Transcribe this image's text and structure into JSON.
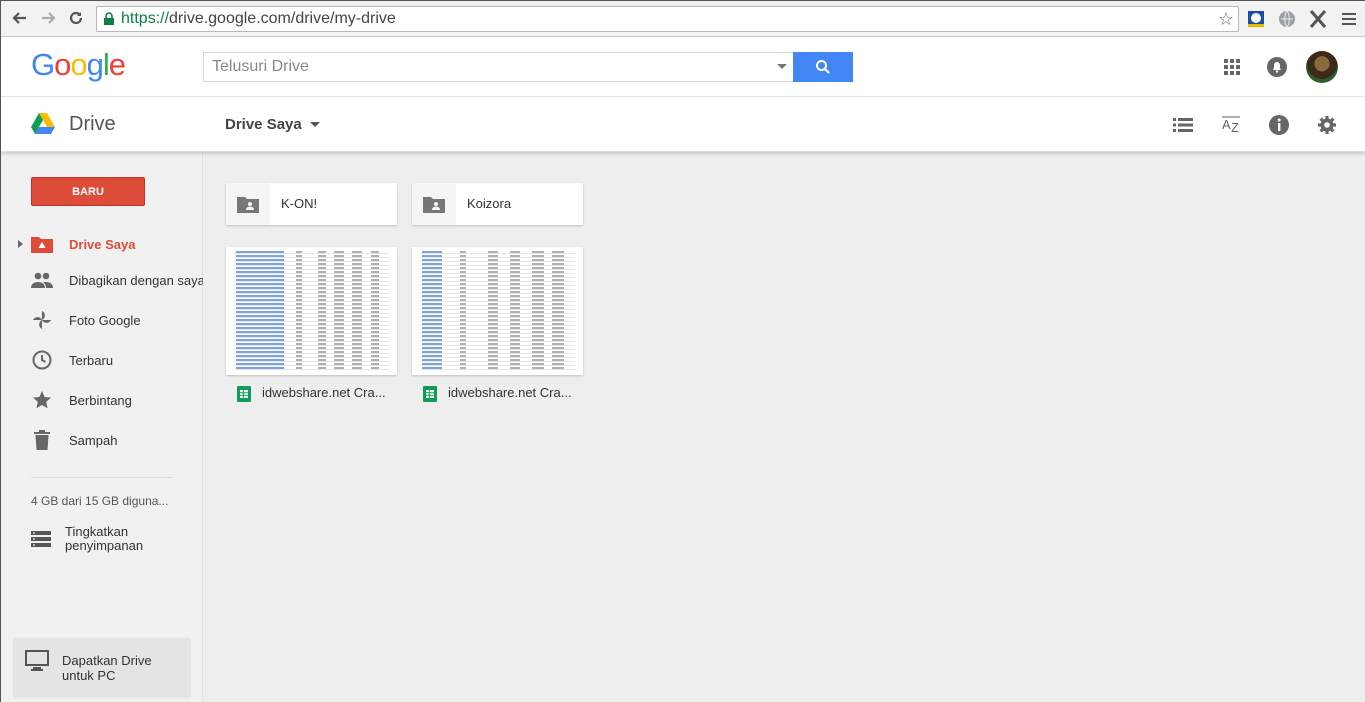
{
  "browser": {
    "url_scheme": "https://",
    "url_rest": "drive.google.com/drive/my-drive"
  },
  "header": {
    "logo": "Google",
    "search_placeholder": "Telusuri Drive"
  },
  "toolbar": {
    "app_name": "Drive",
    "breadcrumb": "Drive Saya"
  },
  "sidebar": {
    "new_button": "BARU",
    "items": [
      {
        "label": "Drive Saya",
        "icon": "my-drive-icon",
        "active": true
      },
      {
        "label": "Dibagikan dengan saya",
        "icon": "shared-people-icon",
        "active": false
      },
      {
        "label": "Foto Google",
        "icon": "photos-pinwheel-icon",
        "active": false
      },
      {
        "label": "Terbaru",
        "icon": "clock-icon",
        "active": false
      },
      {
        "label": "Berbintang",
        "icon": "star-icon",
        "active": false
      },
      {
        "label": "Sampah",
        "icon": "trash-icon",
        "active": false
      }
    ],
    "storage": "4 GB dari 15 GB diguna...",
    "upgrade": "Tingkatkan penyimpanan",
    "get_drive": "Dapatkan Drive untuk PC"
  },
  "main": {
    "folders": [
      {
        "name": "K-ON!"
      },
      {
        "name": "Koizora"
      }
    ],
    "files": [
      {
        "name": "idwebshare.net Cra..."
      },
      {
        "name": "idwebshare.net Cra..."
      }
    ]
  },
  "colors": {
    "new_button": "#dd4b39",
    "search_button": "#4285f4",
    "active_nav": "#dd4b39",
    "sheets_green": "#0f9d58"
  }
}
